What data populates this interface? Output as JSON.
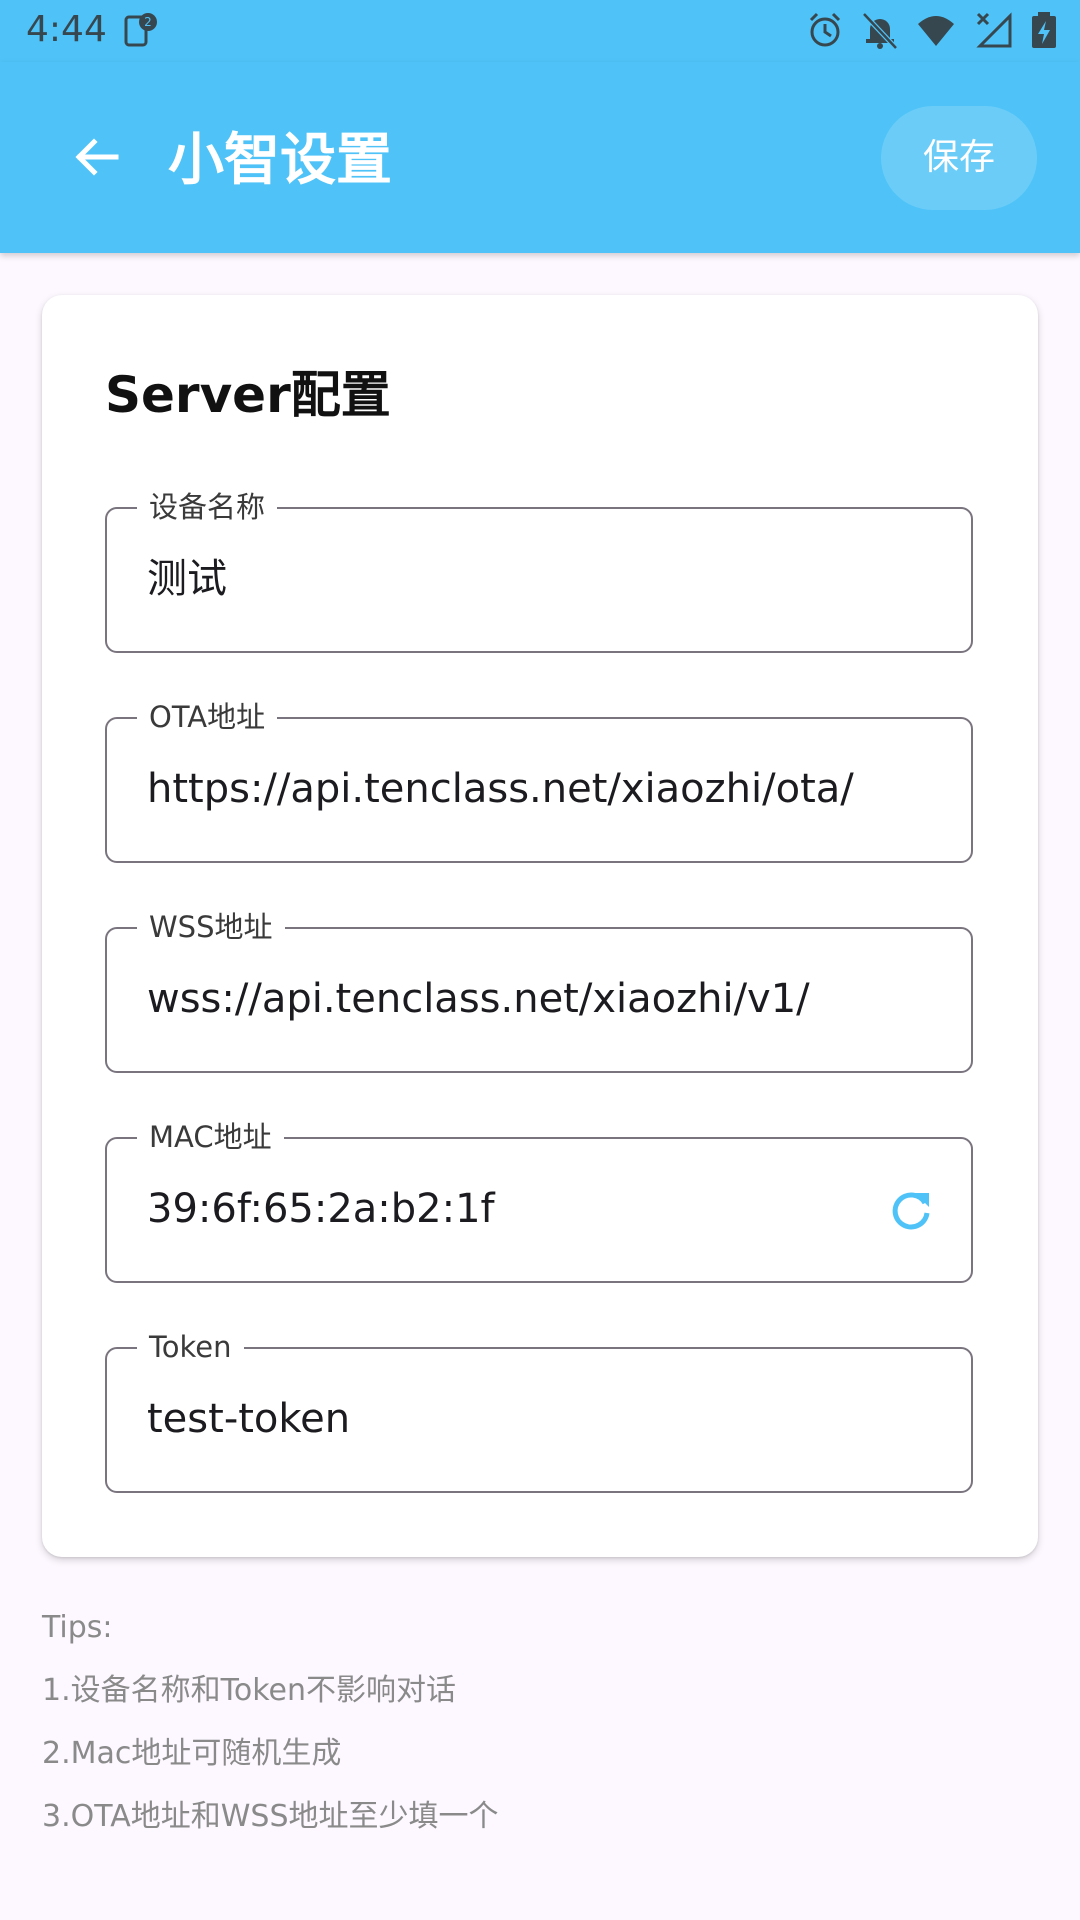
{
  "status_bar": {
    "time": "4:44",
    "icons": [
      "notification-badge-icon",
      "alarm-icon",
      "bell-off-icon",
      "wifi-icon",
      "signal-icon",
      "battery-charging-icon"
    ]
  },
  "app_bar": {
    "title": "小智设置",
    "save_label": "保存",
    "back_icon": "arrow-left-icon",
    "color": "#4fc3f7"
  },
  "card": {
    "title": "Server配置",
    "fields": [
      {
        "label": "设备名称",
        "value": "测试"
      },
      {
        "label": "OTA地址",
        "value": "https://api.tenclass.net/xiaozhi/ota/"
      },
      {
        "label": "WSS地址",
        "value": "wss://api.tenclass.net/xiaozhi/v1/"
      },
      {
        "label": "MAC地址",
        "value": "39:6f:65:2a:b2:1f",
        "action_icon": "refresh-icon"
      },
      {
        "label": "Token",
        "value": "test-token"
      }
    ]
  },
  "tips": {
    "heading": "Tips:",
    "items": [
      "1.设备名称和Token不影响对话",
      "2.Mac地址可随机生成",
      "3.OTA地址和WSS地址至少填一个"
    ]
  }
}
